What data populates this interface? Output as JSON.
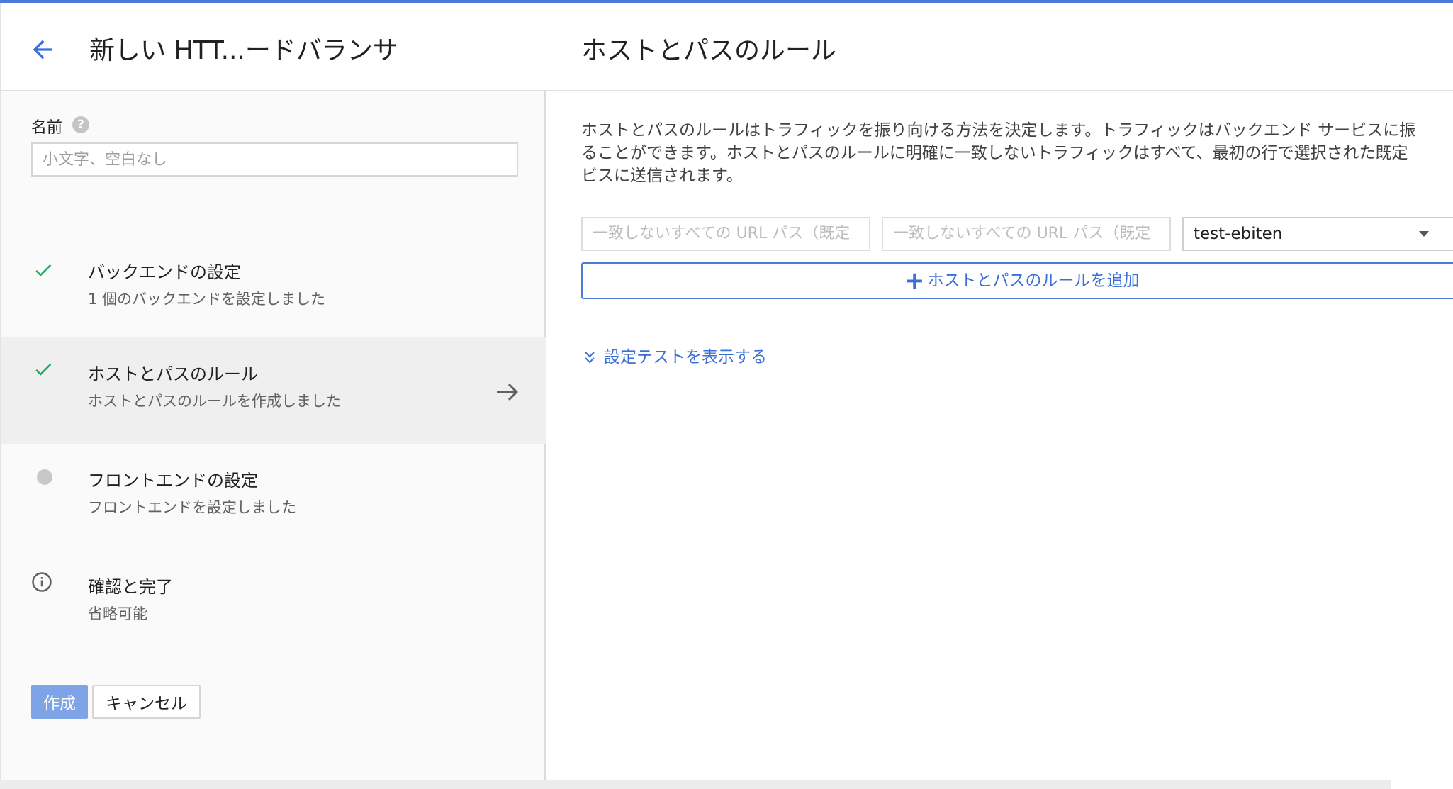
{
  "colors": {
    "accent": "#4a7bdc",
    "link": "#3a6fd8",
    "check": "#1faa59",
    "primary_button_disabled": "#7ea3e6"
  },
  "left": {
    "title": "新しい HTT...ードバランサ",
    "name_label": "名前",
    "name_placeholder": "小文字、空白なし",
    "steps": [
      {
        "title": "バックエンドの設定",
        "subtitle": "1 個のバックエンドを設定しました",
        "status": "done"
      },
      {
        "title": "ホストとパスのルール",
        "subtitle": "ホストとパスのルールを作成しました",
        "status": "done",
        "active": true
      },
      {
        "title": "フロントエンドの設定",
        "subtitle": "フロントエンドを設定しました",
        "status": "pending"
      },
      {
        "title": "確認と完了",
        "subtitle": "省略可能",
        "status": "info"
      }
    ],
    "create_label": "作成",
    "cancel_label": "キャンセル"
  },
  "right": {
    "title": "ホストとパスのルール",
    "description": [
      "ホストとパスのルールはトラフィックを振り向ける方法を決定します。トラフィックはバックエンド サービスに振",
      "ることができます。ホストとパスのルールに明確に一致しないトラフィックはすべて、最初の行で選択された既定",
      "ビスに送信されます。"
    ],
    "host_field": "一致しないすべての URL パス（既定",
    "path_field": "一致しないすべての URL パス（既定",
    "backend_value": "test-ebiten",
    "add_rule_label": "ホストとパスのルールを追加",
    "show_test_label": "設定テストを表示する"
  },
  "icons": {
    "back": "arrow-left-icon",
    "help": "help-icon",
    "done": "check-icon",
    "pending": "dot-icon",
    "info": "info-icon",
    "next": "arrow-right-icon",
    "add": "plus-icon",
    "expand": "chevron-double-down-icon"
  }
}
